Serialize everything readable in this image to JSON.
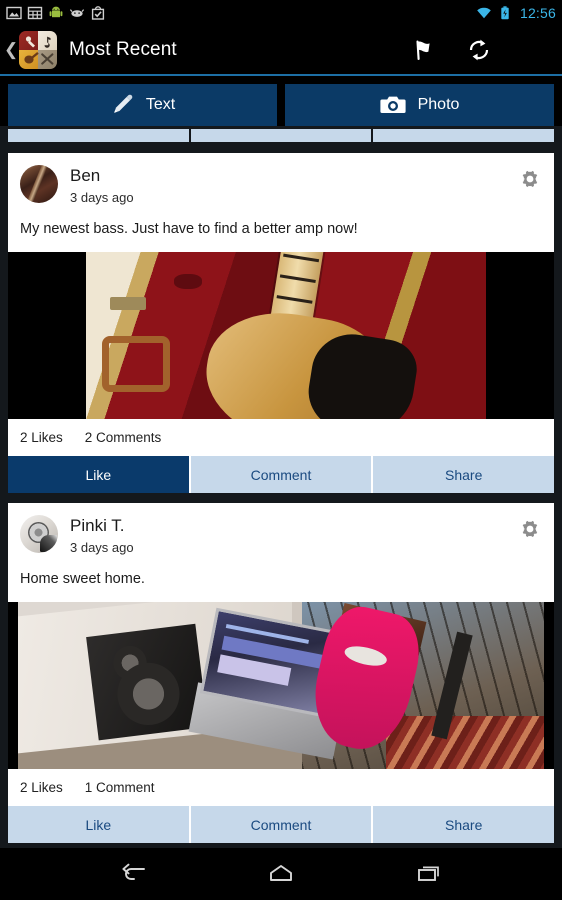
{
  "statusbar": {
    "icons": [
      "gallery-icon",
      "calculator-icon",
      "android-robot-icon",
      "android-face-icon",
      "play-store-bag-icon"
    ],
    "wifi_icon": "wifi-icon",
    "battery_icon": "battery-charging-icon",
    "time": "12:56",
    "accent_color": "#3bb6e8"
  },
  "actionbar": {
    "back_icon": "back-chevron-icon",
    "app_icon": "app-logo-icon",
    "title": "Most Recent",
    "flag_icon": "flag-icon",
    "refresh_icon": "refresh-icon",
    "menu_icon": "hamburger-menu-icon",
    "rule_color": "#1d6fa5"
  },
  "compose": {
    "text_label": "Text",
    "text_icon": "pencil-icon",
    "photo_label": "Photo",
    "photo_icon": "camera-icon",
    "button_color": "#0b3a66"
  },
  "feed": {
    "action_labels": {
      "like": "Like",
      "comment": "Comment",
      "share": "Share"
    },
    "posts": [
      {
        "author": "Ben",
        "time": "3 days ago",
        "body": "My newest bass. Just have to find a better amp now!",
        "avatar_icon": "avatar-ben",
        "gear_icon": "gear-icon",
        "photo_name": "bass-guitar-in-case-photo",
        "likes": "2 Likes",
        "comments": "2 Comments",
        "liked": true
      },
      {
        "author": "Pinki T.",
        "time": "3 days ago",
        "body": "Home sweet home.",
        "avatar_icon": "avatar-pinki",
        "gear_icon": "gear-icon",
        "photo_name": "home-studio-photo",
        "likes": "2 Likes",
        "comments": "1 Comment",
        "liked": false
      }
    ]
  },
  "navbar": {
    "back_icon": "nav-back-icon",
    "home_icon": "nav-home-icon",
    "recents_icon": "nav-recents-icon"
  },
  "colors": {
    "navy": "#0a3a6b",
    "light_blue": "#c6d8ea",
    "background": "#14181c"
  }
}
